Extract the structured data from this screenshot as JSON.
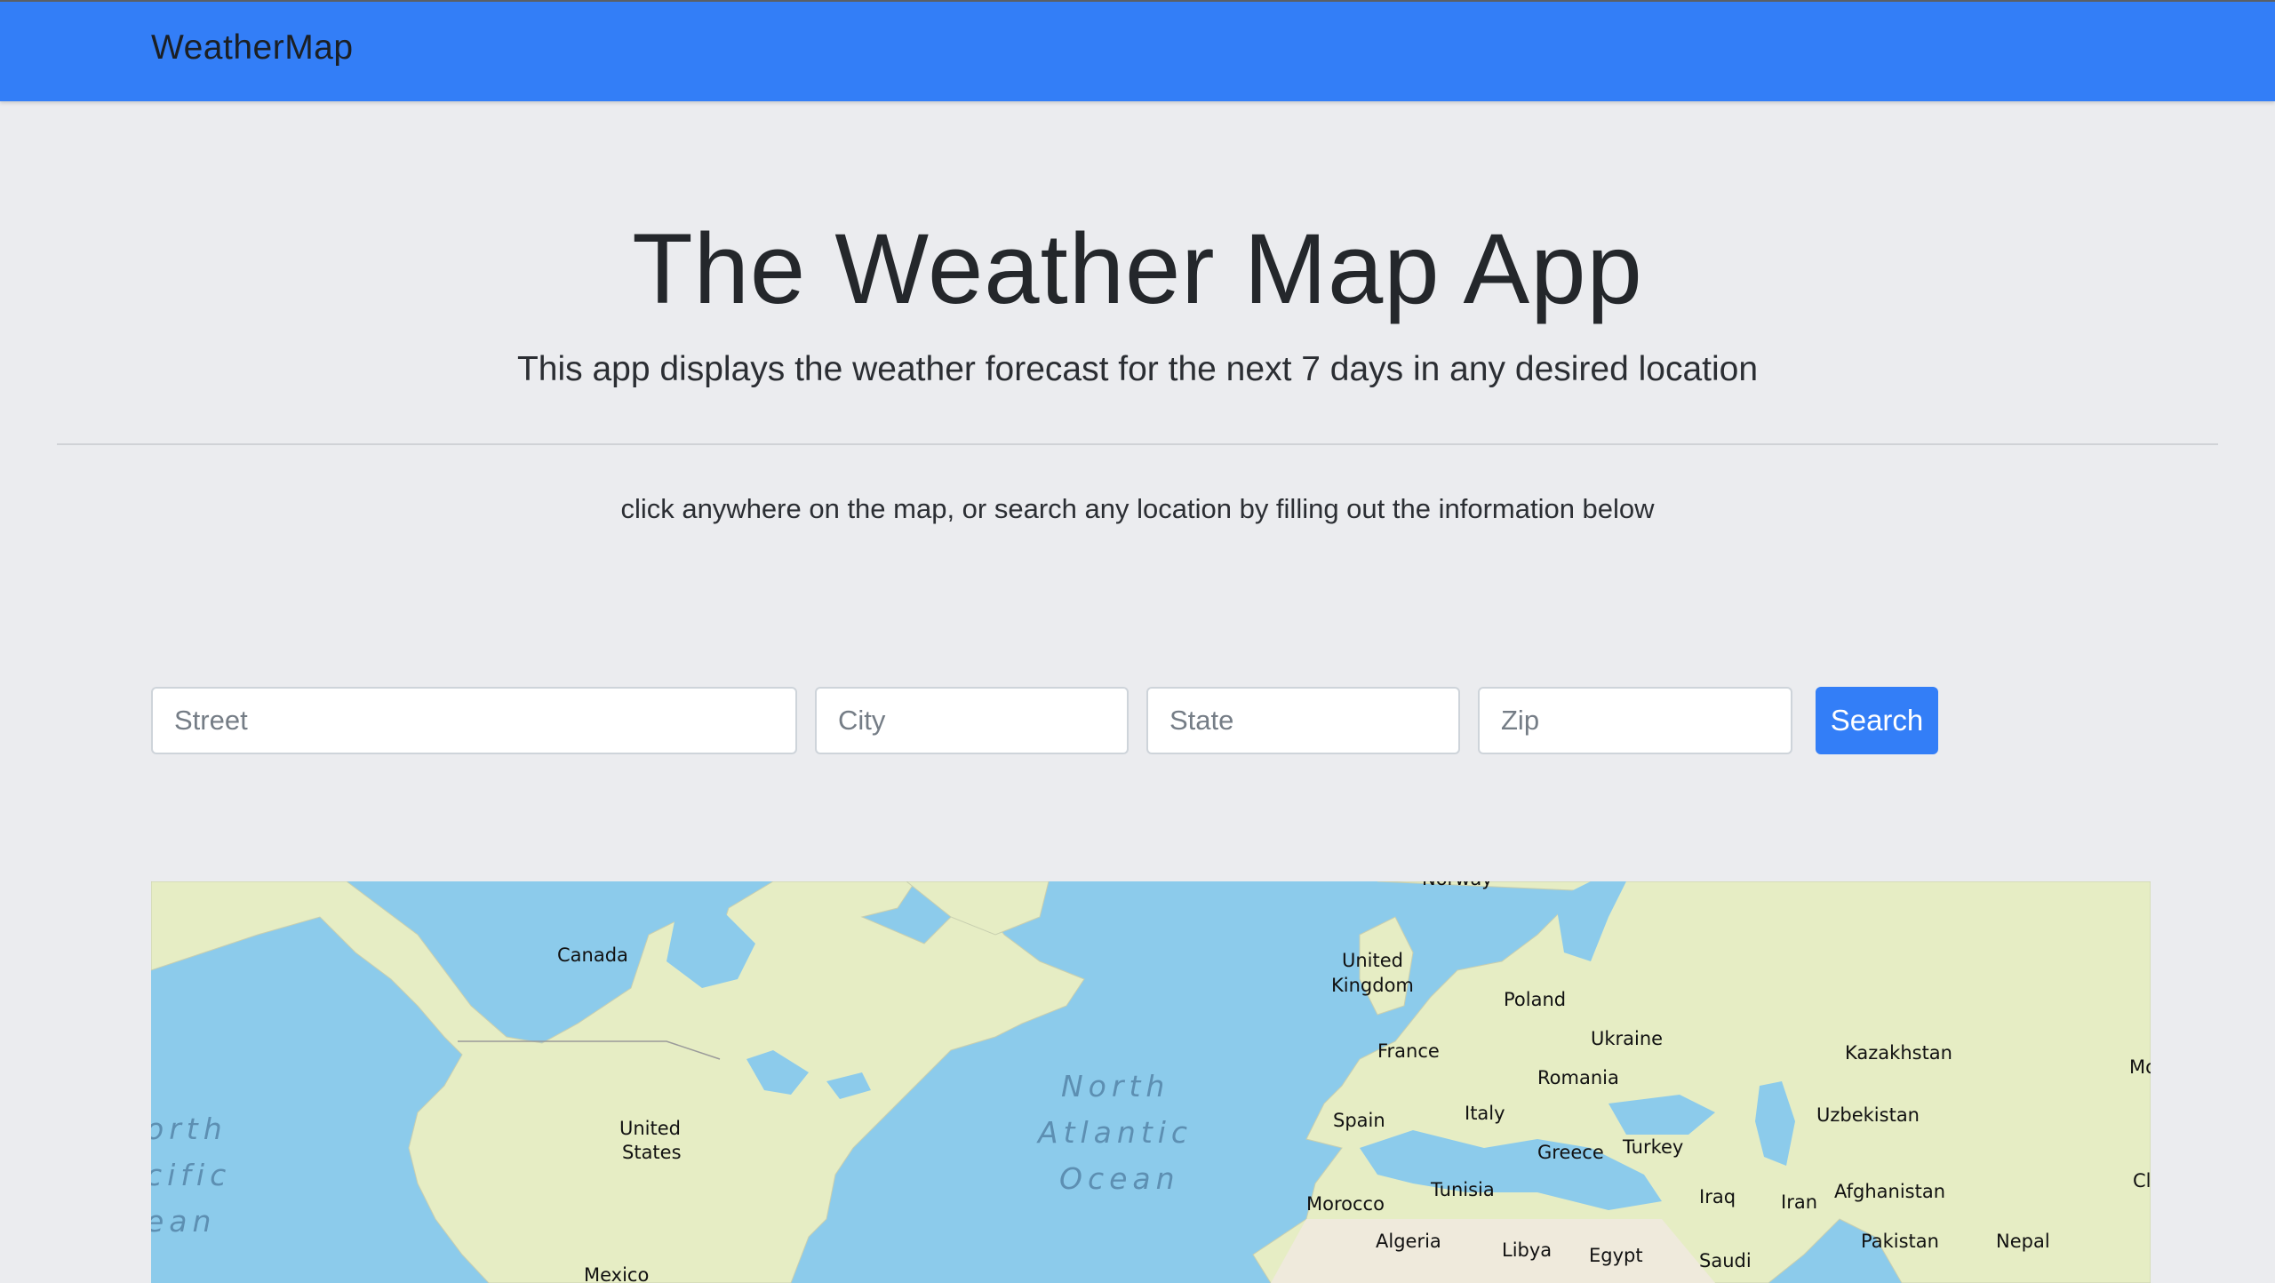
{
  "navbar": {
    "brand": "WeatherMap",
    "color": "#337ef7"
  },
  "hero": {
    "title": "The Weather Map App",
    "subtitle": "This app displays the weather forecast for the next 7 days in any desired location"
  },
  "instructions": "click anywhere on the map, or search any location by filling out the information below",
  "form": {
    "street_placeholder": "Street",
    "city_placeholder": "City",
    "state_placeholder": "State",
    "zip_placeholder": "Zip",
    "search_label": "Search"
  },
  "map": {
    "labels": {
      "canada": "Canada",
      "united_states_1": "United",
      "united_states_2": "States",
      "mexico": "Mexico",
      "north_pacific_1": "orth",
      "north_pacific_2": "cific",
      "north_pacific_3": "ean",
      "north_atlantic_1": "North",
      "north_atlantic_2": "Atlantic",
      "north_atlantic_3": "Ocean",
      "norway": "Norway",
      "uk_1": "United",
      "uk_2": "Kingdom",
      "france": "France",
      "spain": "Spain",
      "poland": "Poland",
      "ukraine": "Ukraine",
      "romania": "Romania",
      "italy": "Italy",
      "greece": "Greece",
      "turkey": "Turkey",
      "tunisia": "Tunisia",
      "morocco": "Morocco",
      "algeria": "Algeria",
      "libya": "Libya",
      "egypt": "Egypt",
      "saudi": "Saudi",
      "iraq": "Iraq",
      "iran": "Iran",
      "afghanistan": "Afghanistan",
      "pakistan": "Pakistan",
      "nepal": "Nepal",
      "kazakhstan": "Kazakhstan",
      "uzbekistan": "Uzbekistan",
      "mo": "Mo",
      "ch": "Cl"
    },
    "water_color": "#8ccbeb",
    "land_color": "#e6edc4"
  }
}
